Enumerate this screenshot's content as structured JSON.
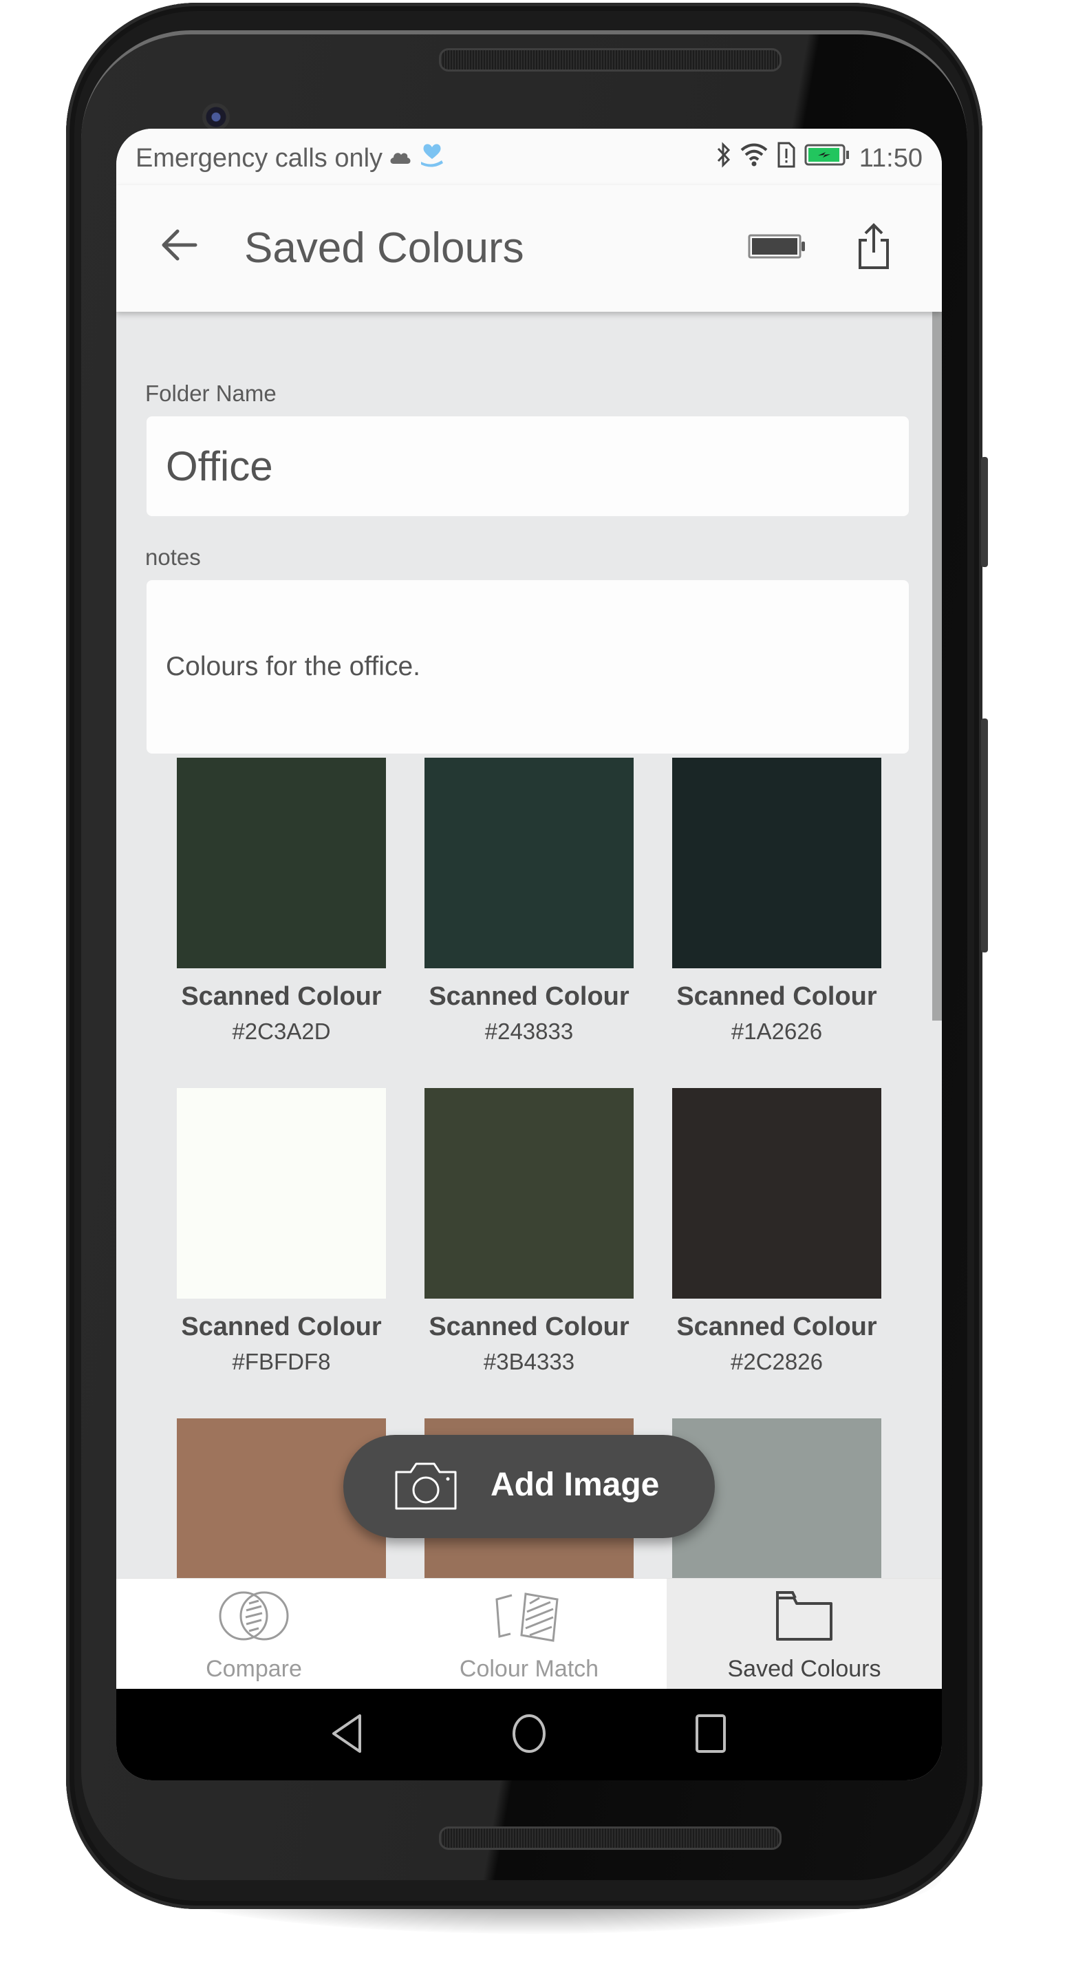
{
  "status_bar": {
    "carrier_text": "Emergency calls only",
    "icons": [
      "cloud-icon",
      "heart-hand-icon",
      "bluetooth-icon",
      "wifi-icon",
      "sim-alert-icon",
      "battery-charging-icon"
    ],
    "battery_color": "#22c55e",
    "time": "11:50"
  },
  "app_bar": {
    "back_icon": "arrow-left-icon",
    "title": "Saved Colours",
    "actions": [
      "battery-icon",
      "share-icon"
    ]
  },
  "form": {
    "folder_name_label": "Folder Name",
    "folder_name_value": "Office",
    "notes_label": "notes",
    "notes_value": "Colours for the office."
  },
  "swatches": [
    {
      "name": "Scanned Colour",
      "hex": "#2C3A2D",
      "color": "#2C3A2D"
    },
    {
      "name": "Scanned Colour",
      "hex": "#243833",
      "color": "#243833"
    },
    {
      "name": "Scanned Colour",
      "hex": "#1A2626",
      "color": "#1A2626"
    },
    {
      "name": "Scanned Colour",
      "hex": "#FBFDF8",
      "color": "#FBFDF8"
    },
    {
      "name": "Scanned Colour",
      "hex": "#3B4333",
      "color": "#3B4333"
    },
    {
      "name": "Scanned Colour",
      "hex": "#2C2826",
      "color": "#2C2826"
    },
    {
      "name": "",
      "hex": "",
      "color": "#9E745C"
    },
    {
      "name": "",
      "hex": "",
      "color": "#98715A"
    },
    {
      "name": "",
      "hex": "",
      "color": "#959D9A"
    }
  ],
  "fab": {
    "icon": "camera-icon",
    "label": "Add Image"
  },
  "bottom_tabs": [
    {
      "label": "Compare",
      "icon": "compare-circles-icon",
      "active": false
    },
    {
      "label": "Colour Match",
      "icon": "colour-match-cards-icon",
      "active": false
    },
    {
      "label": "Saved Colours",
      "icon": "folder-icon",
      "active": true
    }
  ],
  "nav_bar": [
    "back-triangle-icon",
    "home-circle-icon",
    "recents-square-icon"
  ]
}
